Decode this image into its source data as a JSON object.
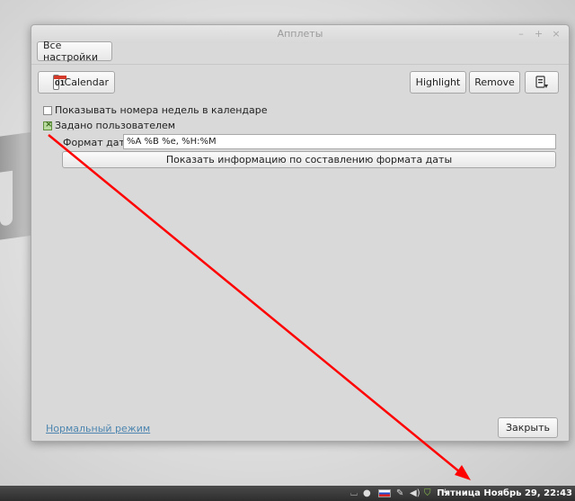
{
  "window": {
    "title": "Апплеты",
    "controls": {
      "minimize": "–",
      "maximize": "+",
      "close": "×"
    }
  },
  "toolbar": {
    "all_settings": "Все настройки"
  },
  "applet": {
    "icon_day": "01",
    "name": "Calendar",
    "highlight": "Highlight",
    "remove": "Remove",
    "extra_icon": "settings-panel-icon"
  },
  "options": {
    "show_week_numbers": {
      "label": "Показывать номера недель в календаре",
      "checked": false
    },
    "custom": {
      "label": "Задано пользователем",
      "checked": true
    },
    "date_format_label": "Формат даты:",
    "date_format_value": "%A %B %e, %H:%M",
    "format_info_button": "Показать информацию по составлению формата даты"
  },
  "footer": {
    "normal_mode": "Нормальный режим",
    "close": "Закрыть"
  },
  "taskbar": {
    "clock": "Пятница Ноябрь 29, 22:43",
    "tray_icons": [
      "desktop-icon",
      "user-icon",
      "flag-ru-icon",
      "pen-icon",
      "volume-icon",
      "shield-icon",
      "network-icon"
    ]
  },
  "colors": {
    "arrow": "#ff0000",
    "link": "#4e86b0"
  }
}
